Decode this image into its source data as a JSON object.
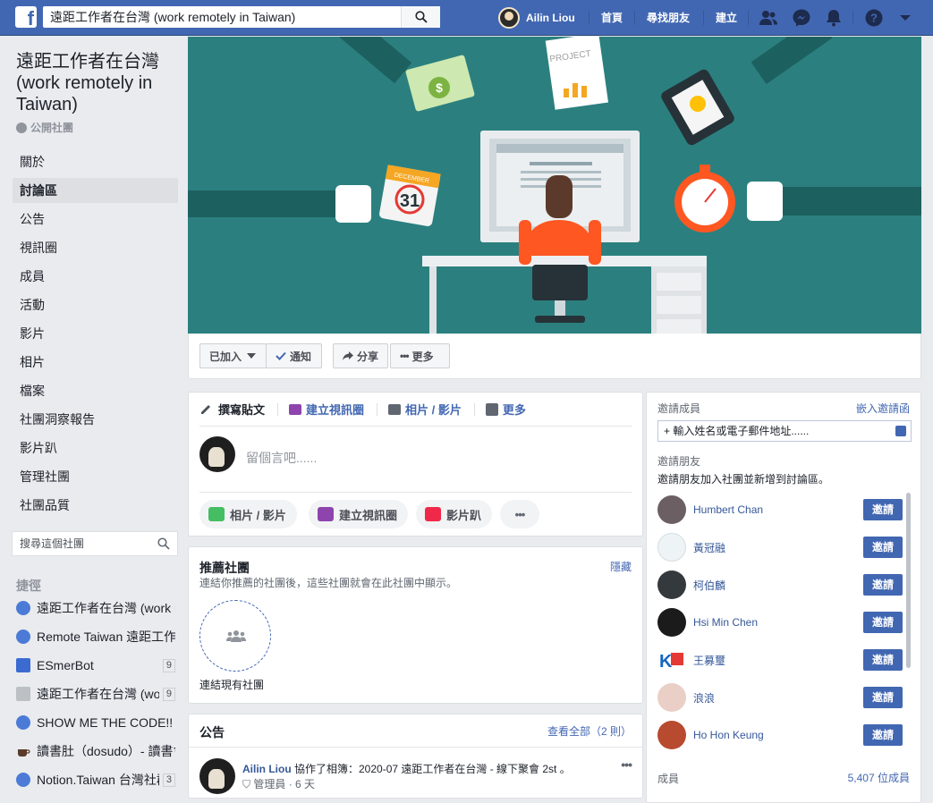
{
  "topbar": {
    "search_value": "遠距工作者在台灣 (work remotely in Taiwan)",
    "user_name": "Ailin Liou",
    "home": "首頁",
    "find_friends": "尋找朋友",
    "create": "建立"
  },
  "group": {
    "title": "遠距工作者在台灣 (work remotely in Taiwan)",
    "privacy": "公開社團"
  },
  "leftnav": {
    "items": [
      {
        "label": "關於"
      },
      {
        "label": "討論區"
      },
      {
        "label": "公告"
      },
      {
        "label": "視訊圈"
      },
      {
        "label": "成員"
      },
      {
        "label": "活動"
      },
      {
        "label": "影片"
      },
      {
        "label": "相片"
      },
      {
        "label": "檔案"
      },
      {
        "label": "社團洞察報告"
      },
      {
        "label": "影片趴"
      },
      {
        "label": "管理社團"
      },
      {
        "label": "社團品質"
      }
    ],
    "search_placeholder": "搜尋這個社團",
    "shortcuts_title": "捷徑",
    "shortcuts": [
      {
        "label": "遠距工作者在台灣 (work remotely in Taiwan)",
        "badge": ""
      },
      {
        "label": "Remote Taiwan 遠距工作",
        "badge": ""
      },
      {
        "label": "ESmerBot",
        "badge": "9"
      },
      {
        "label": "遠距工作者在台灣 (work remotely in Taiwan)",
        "badge": "9"
      },
      {
        "label": "SHOW ME THE CODE!!",
        "badge": ""
      },
      {
        "label": "讀書肚（dosudo）- 讀書會",
        "badge": ""
      },
      {
        "label": "Notion.Taiwan 台灣社群",
        "badge": "3"
      }
    ]
  },
  "cover": {
    "calendar_month": "DECEMBER",
    "calendar_day": "31",
    "project_label": "PROJECT"
  },
  "cover_actions": {
    "joined": "已加入",
    "notify": "通知",
    "share": "分享",
    "more": "更多"
  },
  "composer": {
    "tabs": [
      "撰寫貼文",
      "建立視訊圈",
      "相片 / 影片",
      "更多"
    ],
    "placeholder": "留個言吧......",
    "pills": [
      "相片 / 影片",
      "建立視訊圈",
      "影片趴"
    ]
  },
  "recommended": {
    "title": "推薦社團",
    "hide": "隱藏",
    "subtitle": "連結你推薦的社團後，這些社團就會在此社團中顯示。",
    "link_label": "連結現有社團"
  },
  "announcements": {
    "title": "公告",
    "view_all": "查看全部（2 則）",
    "post_author": "Ailin Liou",
    "post_text": "協作了相簿：2020-07 遠距工作者在台灣 - 線下聚會 2st 。",
    "post_role": "管理員",
    "post_time": "6 天"
  },
  "invite": {
    "invite_members_label": "邀請成員",
    "embed_link": "嵌入邀請函",
    "input_placeholder": "+ 輸入姓名或電子郵件地址......",
    "invite_friends_label": "邀請朋友",
    "invite_friends_desc": "邀請朋友加入社團並新增到討論區。",
    "button_label": "邀請",
    "friends": [
      {
        "name": "Humbert Chan",
        "color": "#6b5f63"
      },
      {
        "name": "黃冠融",
        "color": "#eef3f6"
      },
      {
        "name": "柯伯麟",
        "color": "#33393d"
      },
      {
        "name": "Hsi Min Chen",
        "color": "#1b1b1b"
      },
      {
        "name": "王募璽",
        "color": "#ffffff"
      },
      {
        "name": "浪浪",
        "color": "#e9cfc6"
      },
      {
        "name": "Ho Hon Keung",
        "color": "#b84a2f"
      }
    ],
    "members_label": "成員",
    "members_count": "5,407 位成員"
  }
}
